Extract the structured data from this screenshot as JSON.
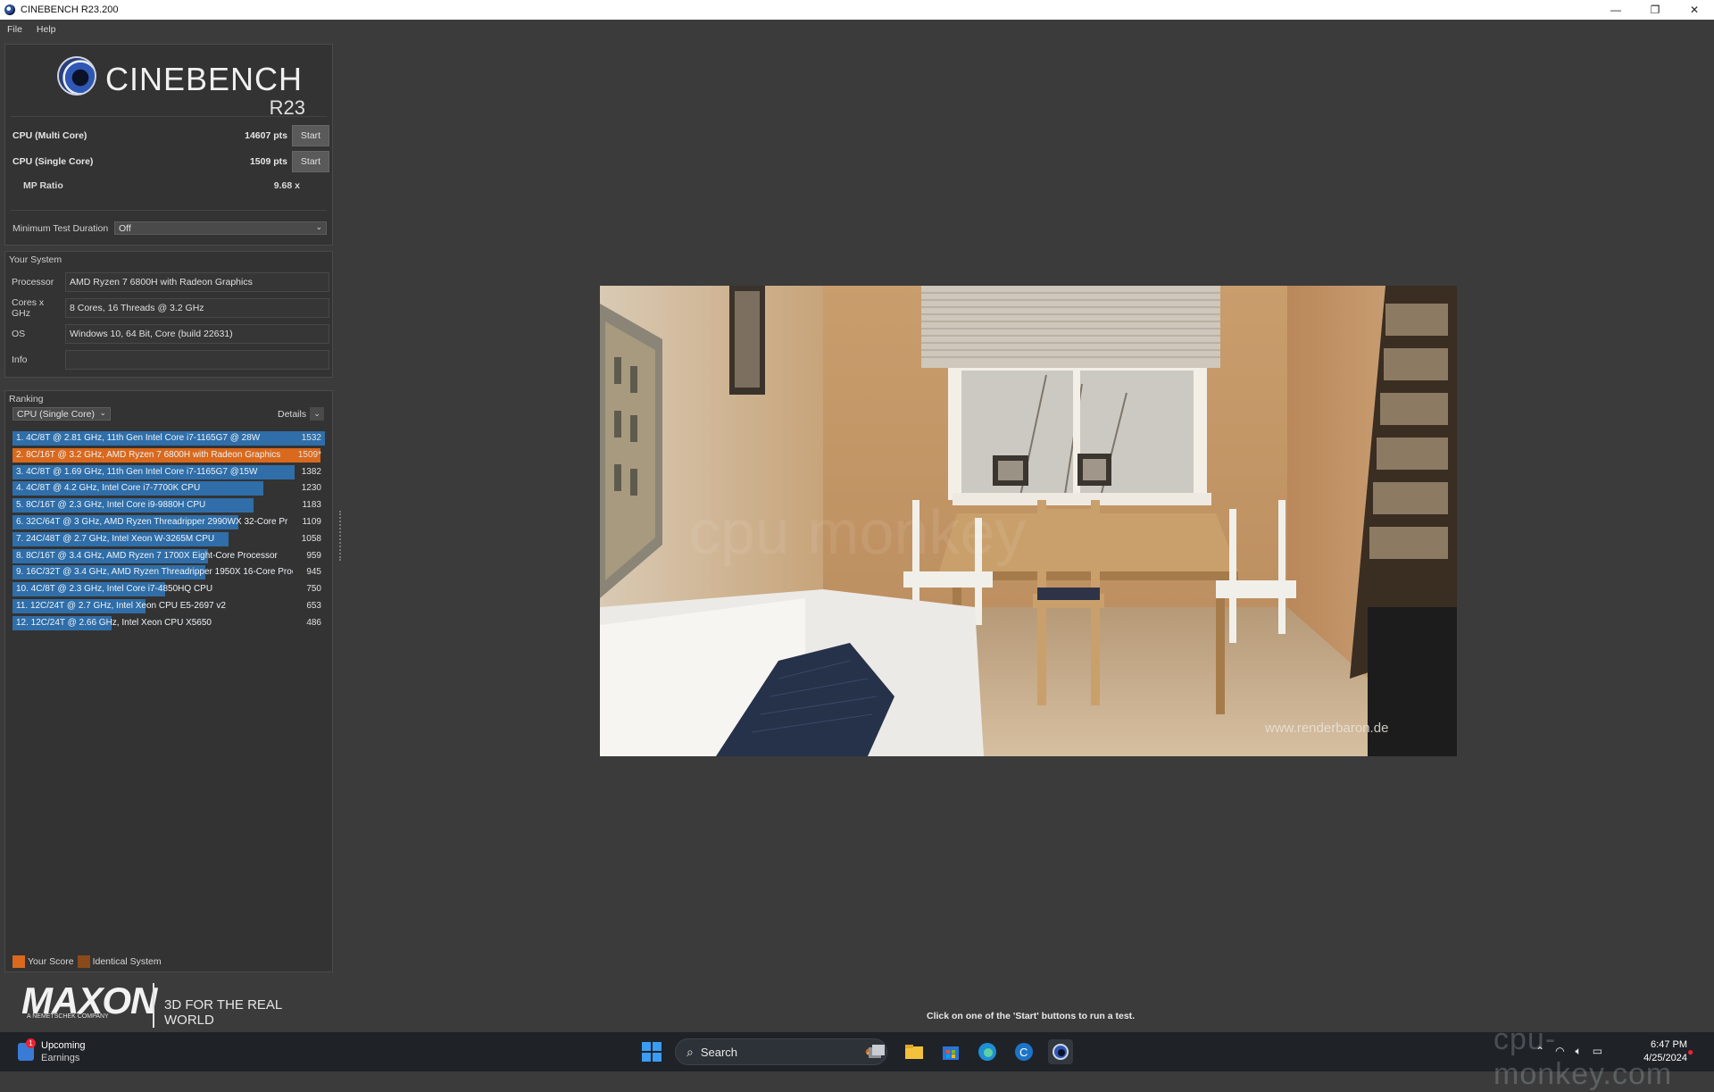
{
  "window": {
    "title": "CINEBENCH R23.200",
    "controls": {
      "minimize": "—",
      "maximize": "❐",
      "close": "✕"
    }
  },
  "menu": [
    "File",
    "Help"
  ],
  "logo": {
    "brand": "CINEBENCH",
    "version": "R23"
  },
  "scores": {
    "multi": {
      "label": "CPU (Multi Core)",
      "value": "14607 pts",
      "button": "Start"
    },
    "single": {
      "label": "CPU (Single Core)",
      "value": "1509 pts",
      "button": "Start"
    },
    "mp_ratio": {
      "label": "MP Ratio",
      "value": "9.68 x"
    }
  },
  "min_test_duration": {
    "label": "Minimum Test Duration",
    "value": "Off"
  },
  "system": {
    "title": "Your System",
    "rows": [
      {
        "label": "Processor",
        "value": "AMD Ryzen 7 6800H with Radeon Graphics"
      },
      {
        "label": "Cores x GHz",
        "value": "8 Cores, 16 Threads @ 3.2 GHz"
      },
      {
        "label": "OS",
        "value": "Windows 10, 64 Bit, Core (build 22631)"
      },
      {
        "label": "Info",
        "value": ""
      }
    ]
  },
  "ranking": {
    "title": "Ranking",
    "selected": "CPU (Single Core)",
    "details_label": "Details",
    "max_score": 1532,
    "items": [
      {
        "text": "1. 4C/8T @ 2.81 GHz, 11th Gen Intel Core i7-1165G7 @ 28W",
        "score": "1532",
        "value": 1532,
        "mine": false
      },
      {
        "text": "2. 8C/16T @ 3.2 GHz, AMD Ryzen 7 6800H with Radeon Graphics",
        "score": "1509*",
        "value": 1509,
        "mine": true
      },
      {
        "text": "3. 4C/8T @ 1.69 GHz, 11th Gen Intel Core i7-1165G7 @15W",
        "score": "1382",
        "value": 1382,
        "mine": false
      },
      {
        "text": "4. 4C/8T @ 4.2 GHz, Intel Core i7-7700K CPU",
        "score": "1230",
        "value": 1230,
        "mine": false
      },
      {
        "text": "5. 8C/16T @ 2.3 GHz, Intel Core i9-9880H CPU",
        "score": "1183",
        "value": 1183,
        "mine": false
      },
      {
        "text": "6. 32C/64T @ 3 GHz, AMD Ryzen Threadripper 2990WX 32-Core Pr",
        "score": "1109",
        "value": 1109,
        "mine": false
      },
      {
        "text": "7. 24C/48T @ 2.7 GHz, Intel Xeon W-3265M CPU",
        "score": "1058",
        "value": 1058,
        "mine": false
      },
      {
        "text": "8. 8C/16T @ 3.4 GHz, AMD Ryzen 7 1700X Eight-Core Processor",
        "score": "959",
        "value": 959,
        "mine": false
      },
      {
        "text": "9. 16C/32T @ 3.4 GHz, AMD Ryzen Threadripper 1950X 16-Core Proc",
        "score": "945",
        "value": 945,
        "mine": false
      },
      {
        "text": "10. 4C/8T @ 2.3 GHz, Intel Core i7-4850HQ CPU",
        "score": "750",
        "value": 750,
        "mine": false
      },
      {
        "text": "11. 12C/24T @ 2.7 GHz, Intel Xeon CPU E5-2697 v2",
        "score": "653",
        "value": 653,
        "mine": false
      },
      {
        "text": "12. 12C/24T @ 2.66 GHz, Intel Xeon CPU X5650",
        "score": "486",
        "value": 486,
        "mine": false
      }
    ],
    "legend": {
      "your_score": "Your Score",
      "identical_system": "Identical System"
    }
  },
  "maxon": {
    "brand": "MAXON",
    "sub": "A NEMETSCHEK COMPANY",
    "slogan": "3D FOR THE REAL WORLD"
  },
  "render": {
    "watermark": "www.renderbaron.de",
    "overlay": "cpu monkey"
  },
  "hint": "Click on one of the 'Start' buttons to run a test.",
  "taskbar": {
    "weather_title": "Upcoming",
    "weather_sub": "Earnings",
    "weather_badge": "1",
    "search": "Search",
    "time": "6:47 PM",
    "date": "4/25/2024"
  },
  "page_watermark": "cpu-monkey.com",
  "colors": {
    "bar": "#2f6ea8",
    "your_score": "#d8691d",
    "identical": "#8a4a1c"
  }
}
